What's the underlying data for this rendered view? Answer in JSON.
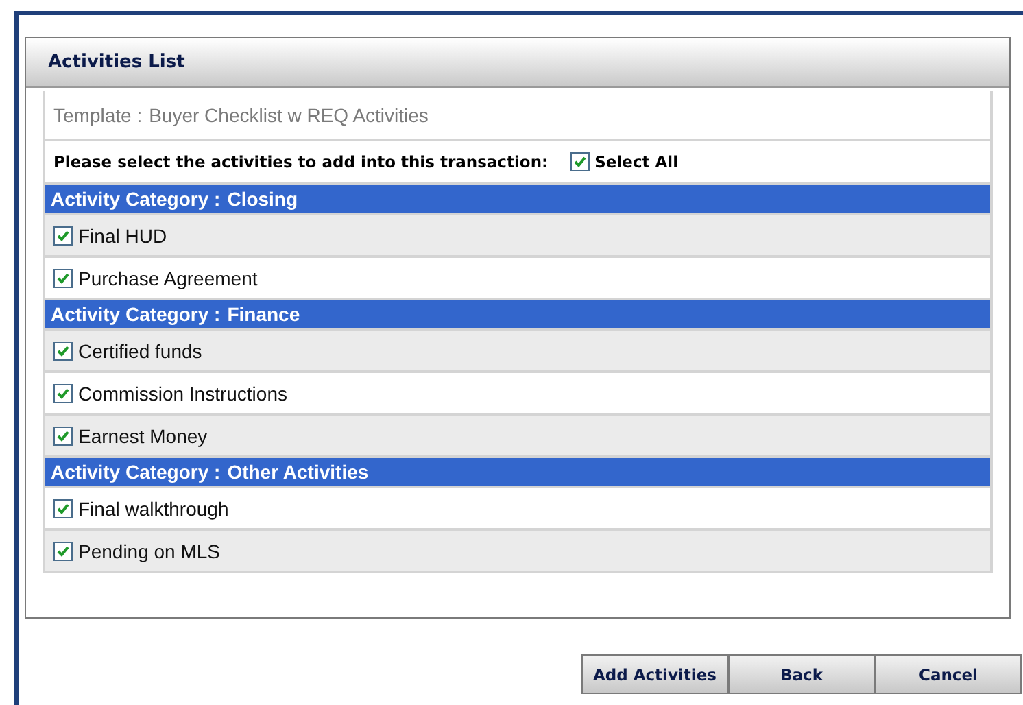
{
  "panel": {
    "title": "Activities List"
  },
  "template": {
    "label": "Template :",
    "value": "Buyer Checklist w REQ Activities"
  },
  "instruction": "Please select the activities to add into this transaction:",
  "select_all": {
    "label": "Select All",
    "checked": true
  },
  "categories": [
    {
      "label": "Activity Category :",
      "name": "Closing",
      "activities": [
        {
          "name": "Final HUD",
          "checked": true
        },
        {
          "name": "Purchase Agreement",
          "checked": true
        }
      ]
    },
    {
      "label": "Activity Category :",
      "name": "Finance",
      "activities": [
        {
          "name": "Certified funds",
          "checked": true
        },
        {
          "name": "Commission Instructions",
          "checked": true
        },
        {
          "name": "Earnest Money",
          "checked": true
        }
      ]
    },
    {
      "label": "Activity Category :",
      "name": "Other Activities",
      "activities": [
        {
          "name": "Final walkthrough",
          "checked": true
        },
        {
          "name": "Pending on MLS",
          "checked": true
        }
      ]
    }
  ],
  "buttons": [
    "Add Activities",
    "Back",
    "Cancel"
  ]
}
